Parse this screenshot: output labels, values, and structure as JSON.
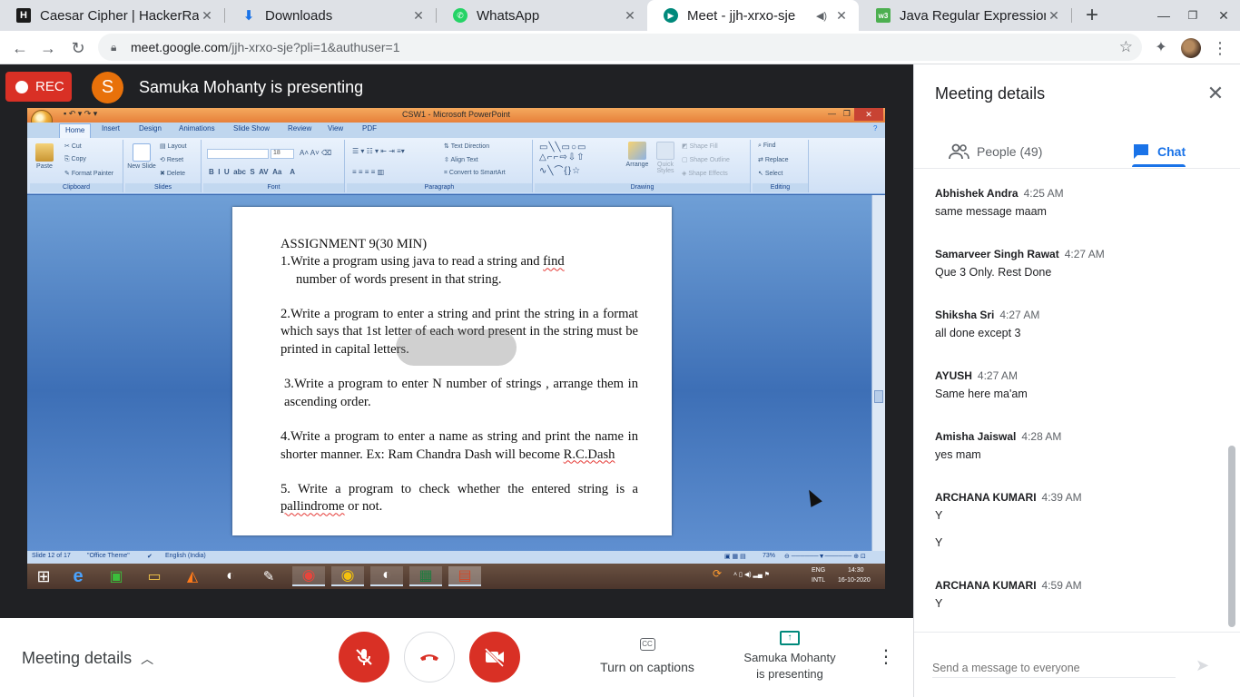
{
  "browser": {
    "tabs": [
      {
        "title": "Caesar Cipher | HackerRa",
        "favicon": "hackerrank-icon",
        "color": "#1ba94c"
      },
      {
        "title": "Downloads",
        "favicon": "download-icon",
        "color": "#1a73e8"
      },
      {
        "title": "WhatsApp",
        "favicon": "whatsapp-icon",
        "color": "#25d366"
      },
      {
        "title": "Meet - jjh-xrxo-sje",
        "favicon": "meet-icon",
        "color": "#00897b",
        "active": true
      },
      {
        "title": "Java Regular Expressions",
        "favicon": "w3schools-icon",
        "color": "#4caf50"
      }
    ],
    "url_host": "meet.google.com",
    "url_path": "/jjh-xrxo-sje?pli=1&authuser=1"
  },
  "meet": {
    "rec_label": "REC",
    "presenter_initial": "S",
    "presenter_text": "Samuka Mohanty is presenting",
    "controls": {
      "meeting_details": "Meeting details",
      "captions": "Turn on captions",
      "presenting_line1": "Samuka Mohanty",
      "presenting_line2": "is presenting"
    }
  },
  "powerpoint": {
    "window_title": "CSW1 - Microsoft PowerPoint",
    "ribbon_tabs": [
      "Home",
      "Insert",
      "Design",
      "Animations",
      "Slide Show",
      "Review",
      "View",
      "PDF"
    ],
    "groups": [
      "Clipboard",
      "Slides",
      "Font",
      "Paragraph",
      "Drawing",
      "Editing"
    ],
    "clipboard": {
      "paste": "Paste",
      "cut": "Cut",
      "copy": "Copy",
      "format_painter": "Format Painter"
    },
    "slides": {
      "new_slide": "New Slide",
      "layout": "Layout",
      "reset": "Reset",
      "delete": "Delete"
    },
    "font_size": "18",
    "paragraph": {
      "text_direction": "Text Direction",
      "align_text": "Align Text",
      "smartart": "Convert to SmartArt"
    },
    "drawing": {
      "arrange": "Arrange",
      "quick_styles": "Quick Styles",
      "shape_fill": "Shape Fill",
      "shape_outline": "Shape Outline",
      "shape_effects": "Shape Effects"
    },
    "editing": {
      "find": "Find",
      "replace": "Replace",
      "select": "Select"
    },
    "slide": {
      "heading": "ASSIGNMENT 9(30 MIN)",
      "q1a": "1.Write a program using java to read a string and ",
      "q1_find": "find",
      "q1b": "number of words present in that string.",
      "q2": "2.Write a program to enter a string and print the string in a format which says that 1st letter of each word present in the string must be printed in capital letters.",
      "q3": "3.Write a program to enter N number of strings , arrange them in ascending order.",
      "q4a": "4.Write a program to enter a name as string and print the name in shorter manner. Ex: Ram Chandra Dash will become ",
      "q4_rc": "R.C.Dash",
      "q5a": "5. Write a program to check whether the entered string is a ",
      "q5_pal": "pallindrome",
      "q5b": " or not."
    },
    "status": {
      "slide": "Slide 12 of 17",
      "theme": "\"Office Theme\"",
      "language": "English (India)",
      "zoom": "73%"
    },
    "tray": {
      "lang1": "ENG",
      "lang2": "INTL",
      "time": "14:30",
      "date": "16-10-2020"
    }
  },
  "panel": {
    "title": "Meeting details",
    "people_tab": "People (49)",
    "chat_tab": "Chat",
    "messages": [
      {
        "name": "Abhishek Andra",
        "time": "4:25 AM",
        "text": "same message maam"
      },
      {
        "name": "Samarveer Singh Rawat",
        "time": "4:27 AM",
        "text": "Que 3 Only. Rest Done"
      },
      {
        "name": "Shiksha Sri",
        "time": "4:27 AM",
        "text": "all done except 3"
      },
      {
        "name": "AYUSH",
        "time": "4:27 AM",
        "text": "Same here ma'am"
      },
      {
        "name": "Amisha Jaiswal",
        "time": "4:28 AM",
        "text": "yes mam"
      },
      {
        "name": "ARCHANA KUMARI",
        "time": "4:39 AM",
        "text": "Y",
        "text2": "Y"
      },
      {
        "name": "ARCHANA KUMARI",
        "time": "4:59 AM",
        "text": "Y"
      }
    ],
    "composer_placeholder": "Send a message to everyone"
  }
}
